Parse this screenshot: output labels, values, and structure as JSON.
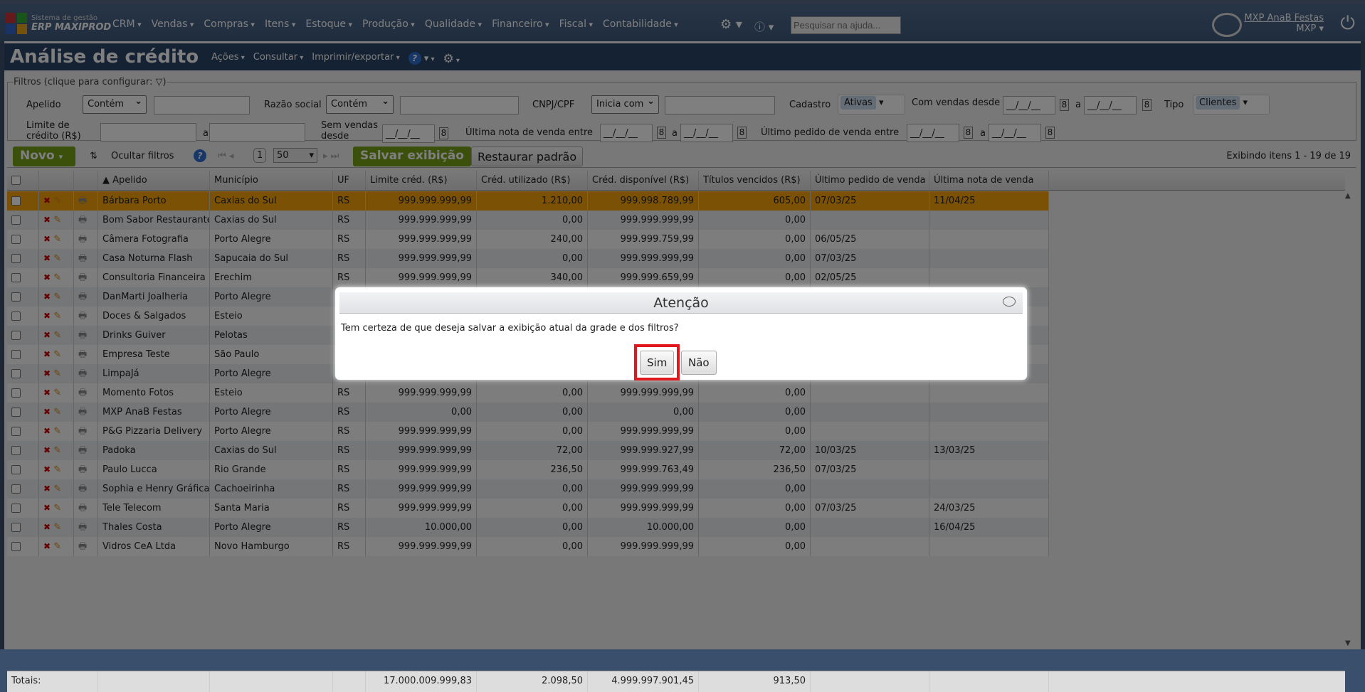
{
  "nav": {
    "logo_line1": "Sistema de gestão",
    "logo_line2": "ERP MAXIPROD",
    "menu": [
      "CRM",
      "Vendas",
      "Compras",
      "Itens",
      "Estoque",
      "Produção",
      "Qualidade",
      "Financeiro",
      "Fiscal",
      "Contabilidade"
    ],
    "help_placeholder": "Pesquisar na ajuda...",
    "user": "MXP AnaB Festas",
    "company": "MXP"
  },
  "page": {
    "title": "Análise de crédito",
    "menu": [
      "Ações",
      "Consultar",
      "Imprimir/exportar"
    ]
  },
  "filters": {
    "legend": "Filtros (clique para configurar:",
    "apelido": "Apelido",
    "apelido_op": "Contém",
    "razao": "Razão social",
    "razao_op": "Contém",
    "cnpj": "CNPJ/CPF",
    "cnpj_op": "Inicia com",
    "cadastro": "Cadastro",
    "cadastro_tag": "Ativas",
    "com_vendas": "Com vendas desde",
    "tipo": "Tipo",
    "tipo_tag": "Clientes",
    "limite": "Limite de crédito (R$)",
    "a": "a",
    "sem_vendas": "Sem vendas desde",
    "ultima_nota": "Última nota de venda entre",
    "ultimo_pedido": "Último pedido de venda entre",
    "date_ph": "__/__/__"
  },
  "toolbar": {
    "novo": "Novo",
    "ocultar": "Ocultar filtros",
    "page": "1",
    "page_size": "50",
    "salvar": "Salvar exibição",
    "restaurar": "Restaurar padrão",
    "info": "Exibindo itens 1 - 19 de 19"
  },
  "columns": [
    "▲ Apelido",
    "Município",
    "UF",
    "Limite créd. (R$)",
    "Créd. utilizado (R$)",
    "Créd. disponível (R$)",
    "Títulos vencidos (R$)",
    "Último pedido de venda",
    "Última nota de venda"
  ],
  "rows": [
    [
      "Bárbara Porto",
      "Caxias do Sul",
      "RS",
      "999.999.999,99",
      "1.210,00",
      "999.998.789,99",
      "605,00",
      "07/03/25",
      "11/04/25"
    ],
    [
      "Bom Sabor Restaurante",
      "Caxias do Sul",
      "RS",
      "999.999.999,99",
      "0,00",
      "999.999.999,99",
      "0,00",
      "",
      ""
    ],
    [
      "Câmera Fotografia",
      "Porto Alegre",
      "RS",
      "999.999.999,99",
      "240,00",
      "999.999.759,99",
      "0,00",
      "06/05/25",
      ""
    ],
    [
      "Casa Noturna Flash",
      "Sapucaia do Sul",
      "RS",
      "999.999.999,99",
      "0,00",
      "999.999.999,99",
      "0,00",
      "07/03/25",
      ""
    ],
    [
      "Consultoria Financeira",
      "Erechim",
      "RS",
      "999.999.999,99",
      "340,00",
      "999.999.659,99",
      "0,00",
      "02/05/25",
      ""
    ],
    [
      "DanMarti Joalheria",
      "Porto Alegre",
      "",
      "",
      "",
      "",
      "",
      "",
      ""
    ],
    [
      "Doces & Salgados",
      "Esteio",
      "",
      "",
      "",
      "",
      "",
      "",
      ""
    ],
    [
      "Drinks Guiver",
      "Pelotas",
      "",
      "",
      "",
      "",
      "",
      "",
      ""
    ],
    [
      "Empresa Teste",
      "São Paulo",
      "",
      "",
      "",
      "",
      "",
      "",
      ""
    ],
    [
      "LimpaJá",
      "Porto Alegre",
      "",
      "",
      "",
      "",
      "",
      "",
      ""
    ],
    [
      "Momento Fotos",
      "Esteio",
      "RS",
      "999.999.999,99",
      "0,00",
      "999.999.999,99",
      "0,00",
      "",
      ""
    ],
    [
      "MXP AnaB Festas",
      "Porto Alegre",
      "RS",
      "0,00",
      "0,00",
      "0,00",
      "0,00",
      "",
      ""
    ],
    [
      "P&G Pizzaria Delivery",
      "Porto Alegre",
      "RS",
      "999.999.999,99",
      "0,00",
      "999.999.999,99",
      "0,00",
      "",
      ""
    ],
    [
      "Padoka",
      "Caxias do Sul",
      "RS",
      "999.999.999,99",
      "72,00",
      "999.999.927,99",
      "72,00",
      "10/03/25",
      "13/03/25"
    ],
    [
      "Paulo Lucca",
      "Rio Grande",
      "RS",
      "999.999.999,99",
      "236,50",
      "999.999.763,49",
      "236,50",
      "07/03/25",
      ""
    ],
    [
      "Sophia e Henry Gráfica",
      "Cachoeirinha",
      "RS",
      "999.999.999,99",
      "0,00",
      "999.999.999,99",
      "0,00",
      "",
      ""
    ],
    [
      "Tele Telecom",
      "Santa Maria",
      "RS",
      "999.999.999,99",
      "0,00",
      "999.999.999,99",
      "0,00",
      "07/03/25",
      "24/03/25"
    ],
    [
      "Thales Costa",
      "Porto Alegre",
      "RS",
      "10.000,00",
      "0,00",
      "10.000,00",
      "0,00",
      "",
      "16/04/25"
    ],
    [
      "Vidros CeA Ltda",
      "Novo Hamburgo",
      "RS",
      "999.999.999,99",
      "0,00",
      "999.999.999,99",
      "0,00",
      "",
      ""
    ]
  ],
  "totals": {
    "label": "Totais:",
    "limite": "17.000.009.999,83",
    "utilizado": "2.098,50",
    "disponivel": "4.999.997.901,45",
    "vencidos": "913,50"
  },
  "modal": {
    "title": "Atenção",
    "message": "Tem certeza de que deseja salvar a exibição atual da grade e dos filtros?",
    "yes": "Sim",
    "no": "Não"
  }
}
